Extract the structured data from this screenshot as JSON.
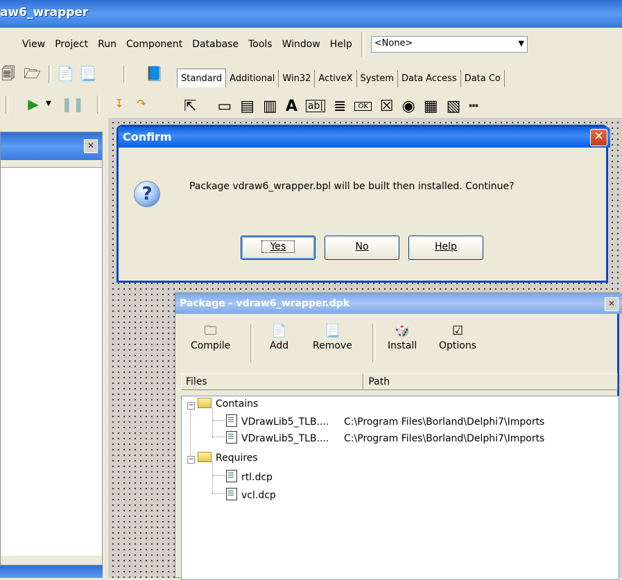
{
  "ide": {
    "title": "aw6_wrapper",
    "menu": [
      "View",
      "Project",
      "Run",
      "Component",
      "Database",
      "Tools",
      "Window",
      "Help"
    ],
    "combo_value": "<None>"
  },
  "palette": {
    "tabs": [
      "Standard",
      "Additional",
      "Win32",
      "ActiveX",
      "System",
      "Data Access",
      "Data Co"
    ],
    "icons": [
      "pointer-icon",
      "frame-icon",
      "mainmenu-icon",
      "popupmenu-icon",
      "label-icon",
      "edit-icon",
      "memo-icon",
      "button-icon",
      "checkbox-icon",
      "radiobutton-icon",
      "listbox-icon",
      "combobox-icon",
      "scrollbar-icon"
    ]
  },
  "dialog": {
    "title": "Confirm",
    "message": "Package vdraw6_wrapper.bpl will be built then installed. Continue?",
    "buttons": {
      "yes": {
        "label": "Yes"
      },
      "no": {
        "label": "No"
      },
      "help": {
        "label": "Help"
      }
    }
  },
  "package": {
    "title": "Package - vdraw6_wrapper.dpk",
    "toolbar": {
      "compile": "Compile",
      "add": "Add",
      "remove": "Remove",
      "install": "Install",
      "options": "Options"
    },
    "columns": {
      "files": "Files",
      "path": "Path"
    },
    "tree": {
      "contains": {
        "label": "Contains",
        "items": [
          {
            "name": "VDrawLib5_TLB....",
            "path": "C:\\Program Files\\Borland\\Delphi7\\Imports"
          },
          {
            "name": "VDrawLib5_TLB....",
            "path": "C:\\Program Files\\Borland\\Delphi7\\Imports"
          }
        ]
      },
      "requires": {
        "label": "Requires",
        "items": [
          {
            "name": "rtl.dcp"
          },
          {
            "name": "vcl.dcp"
          }
        ]
      }
    }
  },
  "colors": {
    "xp_blue": "#0a47c4",
    "face": "#ece9d8",
    "close_red": "#c43c17"
  }
}
